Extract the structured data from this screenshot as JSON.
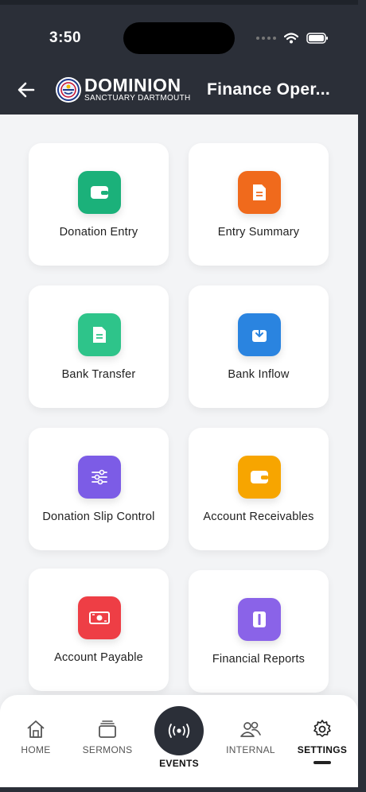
{
  "status": {
    "time": "3:50"
  },
  "header": {
    "logo_main": "DOMINION",
    "logo_sub": "SANCTUARY DARTMOUTH",
    "title": "Finance Oper..."
  },
  "menu": [
    {
      "label": "Donation Entry",
      "icon": "wallet-icon",
      "color": "#1bb17a"
    },
    {
      "label": "Entry Summary",
      "icon": "document-icon",
      "color": "#f06a1c"
    },
    {
      "label": "Bank Transfer",
      "icon": "document-icon",
      "color": "#2ec48a"
    },
    {
      "label": "Bank Inflow",
      "icon": "download-box-icon",
      "color": "#2a84e0"
    },
    {
      "label": "Donation Slip Control",
      "icon": "sliders-icon",
      "color": "#7c5ce6"
    },
    {
      "label": "Account Receivables",
      "icon": "wallet-icon",
      "color": "#f7a500"
    },
    {
      "label": "Account Payable",
      "icon": "banknote-icon",
      "color": "#ee3e45"
    },
    {
      "label": "Financial Reports",
      "icon": "book-icon",
      "color": "#8a63e8"
    }
  ],
  "nav": {
    "home": "HOME",
    "sermons": "SERMONS",
    "events": "EVENTS",
    "internal": "INTERNAL",
    "settings": "SETTINGS"
  }
}
